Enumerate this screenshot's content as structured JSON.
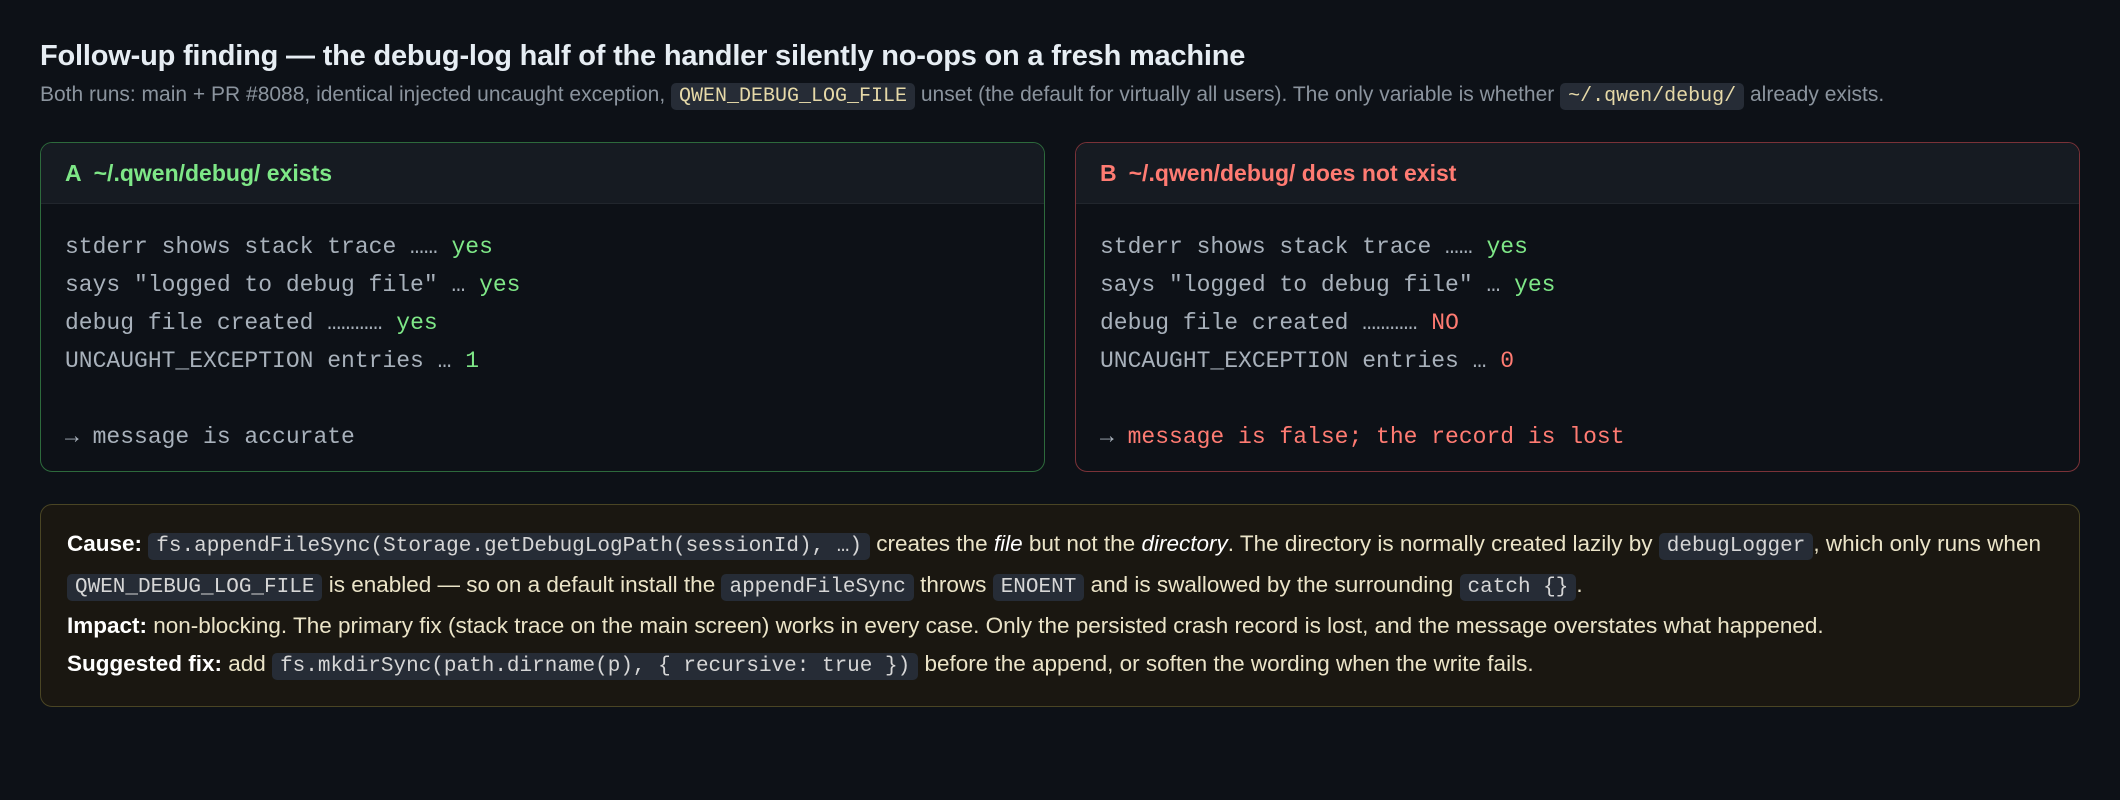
{
  "title": "Follow-up finding — the debug-log half of the handler silently no-ops on a fresh machine",
  "subtitle": {
    "part1": "Both runs: main + PR #8088, identical injected uncaught exception, ",
    "code1": "QWEN_DEBUG_LOG_FILE",
    "part2": " unset (the default for virtually all users). The only variable is whether ",
    "code2": "~/.qwen/debug/",
    "part3": " already exists."
  },
  "panels": {
    "a": {
      "letter": "A",
      "title": "~/.qwen/debug/ exists",
      "rows": [
        {
          "label": "stderr shows stack trace …… ",
          "value": "yes"
        },
        {
          "label": "says \"logged to debug file\" … ",
          "value": "yes"
        },
        {
          "label": "debug file created ………… ",
          "value": "yes"
        },
        {
          "label": "UNCAUGHT_EXCEPTION entries … ",
          "value": "1"
        }
      ],
      "conclusion": "→ message is accurate"
    },
    "b": {
      "letter": "B",
      "title": "~/.qwen/debug/ does not exist",
      "rows": [
        {
          "label": "stderr shows stack trace …… ",
          "value": "yes"
        },
        {
          "label": "says \"logged to debug file\" … ",
          "value": "yes"
        },
        {
          "label": "debug file created ………… ",
          "value": "NO"
        },
        {
          "label": "UNCAUGHT_EXCEPTION entries … ",
          "value": "0"
        }
      ],
      "conclusion_arrow": "→ ",
      "conclusion": "message is false; the record is lost"
    }
  },
  "cause": {
    "cause_label": "Cause:",
    "c1": "fs.appendFileSync(Storage.getDebugLogPath(sessionId), …)",
    "t1": " creates the ",
    "em1": "file",
    "t2": " but not the ",
    "em2": "directory",
    "t3": ". The directory is normally created lazily by ",
    "c2": "debugLogger",
    "t4": ", which only runs when ",
    "c3": "QWEN_DEBUG_LOG_FILE",
    "t5": " is enabled — so on a default install the ",
    "c4": "appendFileSync",
    "t6": " throws ",
    "c5": "ENOENT",
    "t7": " and is swallowed by the surrounding ",
    "c6": "catch {}",
    "t8": ".",
    "impact_label": "Impact:",
    "impact": " non-blocking. The primary fix (stack trace on the main screen) works in every case. Only the persisted crash record is lost, and the message overstates what happened.",
    "fix_label": "Suggested fix:",
    "f1": " add ",
    "fc": "fs.mkdirSync(path.dirname(p), { recursive: true })",
    "f2": " before the append, or soften the wording when the write fails."
  }
}
